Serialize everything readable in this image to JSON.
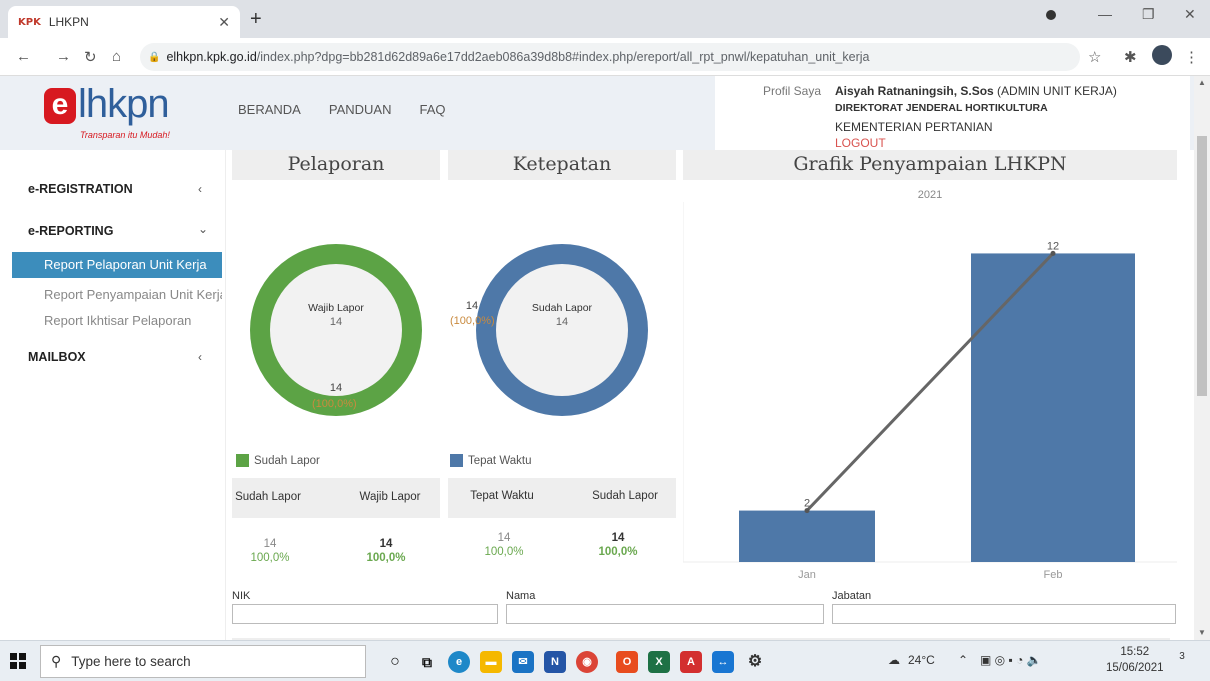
{
  "browser": {
    "tab_title": "LHKPN",
    "tab_favicon": "KPK",
    "url_host": "elhkpn.kpk.go.id",
    "url_path": "/index.php?dpg=bb281d62d89a6e17dd2aeb086a39d8b8#index.php/ereport/all_rpt_pnwl/kepatuhan_unit_kerja"
  },
  "header": {
    "logo_e": "e",
    "logo_rest": "lhkpn",
    "logo_tagline": "Transparan itu Mudah!",
    "nav": [
      "BERANDA",
      "PANDUAN",
      "FAQ"
    ]
  },
  "profile": {
    "image_alt": "Profil Saya",
    "name": "Aisyah Ratnaningsih, S.Sos",
    "role": "(ADMIN UNIT KERJA)",
    "directorate": "DIREKTORAT JENDERAL HORTIKULTURA",
    "ministry": "KEMENTERIAN PERTANIAN",
    "logout": "LOGOUT"
  },
  "sidebar": {
    "group1": "e-REGISTRATION",
    "group2": "e-REPORTING",
    "items": [
      "Report Pelaporan Unit Kerja",
      "Report Penyampaian Unit Kerja",
      "Report Ikhtisar Pelaporan"
    ],
    "group3": "MAILBOX"
  },
  "pelaporan": {
    "title": "Pelaporan",
    "center_label": "Wajib Lapor",
    "center_value": "14",
    "ring_value": "14",
    "ring_pct": "(100,0%)",
    "legend": "Sudah Lapor",
    "col1_header": "Sudah Lapor",
    "col2_header": "Wajib Lapor",
    "col1_value": "14",
    "col1_pct": "100,0%",
    "col2_value": "14",
    "col2_pct": "100,0%",
    "color": "#5ca345"
  },
  "ketepatan": {
    "title": "Ketepatan",
    "center_label": "Sudah Lapor",
    "center_value": "14",
    "ring_value": "14",
    "ring_pct": "(100,0%)",
    "legend": "Tepat Waktu",
    "col1_header": "Tepat Waktu",
    "col2_header": "Sudah Lapor",
    "col1_value": "14",
    "col1_pct": "100,0%",
    "col2_value": "14",
    "col2_pct": "100,0%",
    "color": "#4e78a8"
  },
  "chart_data": {
    "type": "bar",
    "title": "Grafik Penyampaian LHKPN",
    "subtitle": "2021",
    "categories": [
      "Jan",
      "Feb"
    ],
    "values": [
      2,
      12
    ],
    "ylim": [
      0,
      14
    ],
    "color": "#4e78a8",
    "line_overlay": true
  },
  "form": {
    "nik_label": "NIK",
    "nama_label": "Nama",
    "jabatan_label": "Jabatan"
  },
  "taskbar": {
    "search_placeholder": "Type here to search",
    "weather": "24°C",
    "time": "15:52",
    "date": "15/06/2021",
    "notifications": "3"
  }
}
